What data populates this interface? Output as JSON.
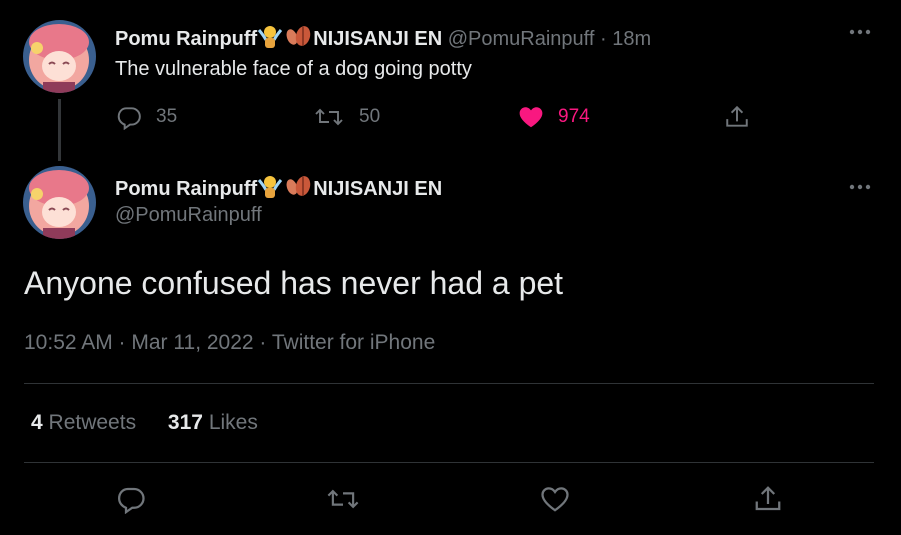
{
  "reply_tweet": {
    "display_name": "Pomu Rainpuff",
    "display_name_suffix": "NIJISANJI EN",
    "handle": "@PomuRainpuff",
    "separator": "·",
    "time": "18m",
    "text": "The vulnerable face of a dog going potty",
    "actions": {
      "replies": "35",
      "retweets": "50",
      "likes": "974"
    },
    "like_color": "#f91880"
  },
  "main_tweet": {
    "display_name": "Pomu Rainpuff",
    "display_name_suffix": "NIJISANJI EN",
    "handle": "@PomuRainpuff",
    "text": "Anyone confused has never had a pet",
    "timestamp": "10:52 AM · Mar 11, 2022 · Twitter for iPhone",
    "retweets_count": "4",
    "retweets_label": "Retweets",
    "likes_count": "317",
    "likes_label": "Likes"
  },
  "icons": {
    "reply": "reply-icon",
    "retweet": "retweet-icon",
    "like": "heart-icon",
    "share": "share-icon",
    "more": "more-icon",
    "emoji_fairy": "fairy-emoji-icon",
    "emoji_leaves": "leaves-emoji-icon"
  },
  "colors": {
    "background": "#000000",
    "text_primary": "#e7e9ea",
    "text_secondary": "#71767b",
    "divider": "#2f3336",
    "like_accent": "#f91880"
  }
}
